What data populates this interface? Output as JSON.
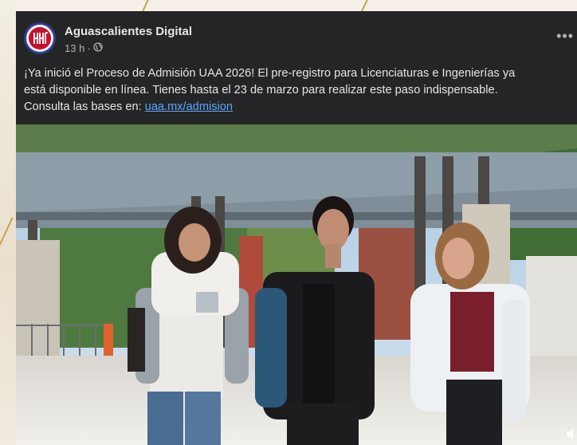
{
  "post": {
    "page_name": "Aguascalientes Digital",
    "timestamp": "13 h",
    "separator": "·",
    "privacy_icon": "globe-icon",
    "more_icon": "more-options-icon",
    "text_lines": [
      "¡Ya inició el Proceso de Admisión UAA 2026! El pre-registro para Licenciaturas e Ingenierías ya",
      "está disponible en línea. Tienes hasta el 23 de marzo para realizar este paso indispensable.",
      "Consulta las bases en: "
    ],
    "link_text": "uaa.mx/admision"
  },
  "media": {
    "type": "photo",
    "icons": [
      "video-sound-icon"
    ]
  },
  "colors": {
    "card_bg": "#242526",
    "text": "#e4e6eb",
    "secondary_text": "#b0b3b8",
    "link": "#5aa7ff",
    "avatar_red": "#c8102e",
    "avatar_blue": "#2c3f8f"
  }
}
